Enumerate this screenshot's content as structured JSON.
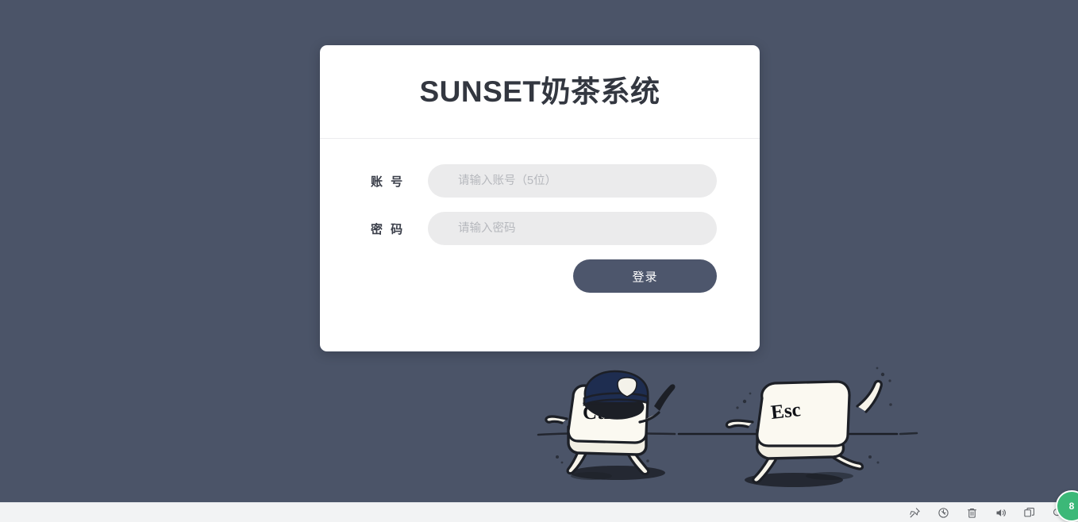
{
  "theme": {
    "page_background": "#4b5468",
    "card_background": "#ffffff",
    "title_color": "#333740",
    "input_background": "#ebebec",
    "button_background": "#4d566c",
    "taskbar_background": "#f2f3f4",
    "badge_color": "#3cb878"
  },
  "login": {
    "title": "SUNSET奶茶系统",
    "fields": [
      {
        "label": "账 号",
        "placeholder": "请输入账号（5位）",
        "value": "",
        "type": "text",
        "name": "account"
      },
      {
        "label": "密 码",
        "placeholder": "请输入密码",
        "value": "",
        "type": "password",
        "name": "password"
      }
    ],
    "submit_label": "登录"
  },
  "illustration": {
    "alt": "卡通插图：戴警帽的 Ctrl 键追赶 Esc 键",
    "left_key_label": "Ctrl",
    "right_key_label": "Esc"
  },
  "taskbar": {
    "icons": [
      {
        "name": "pin-icon",
        "title": "固定"
      },
      {
        "name": "record-icon",
        "title": "录制"
      },
      {
        "name": "trash-icon",
        "title": "删除"
      },
      {
        "name": "speaker-icon",
        "title": "音量"
      },
      {
        "name": "window-copy-icon",
        "title": "窗口"
      },
      {
        "name": "search-icon",
        "title": "搜索"
      }
    ],
    "badge_text": "8"
  }
}
